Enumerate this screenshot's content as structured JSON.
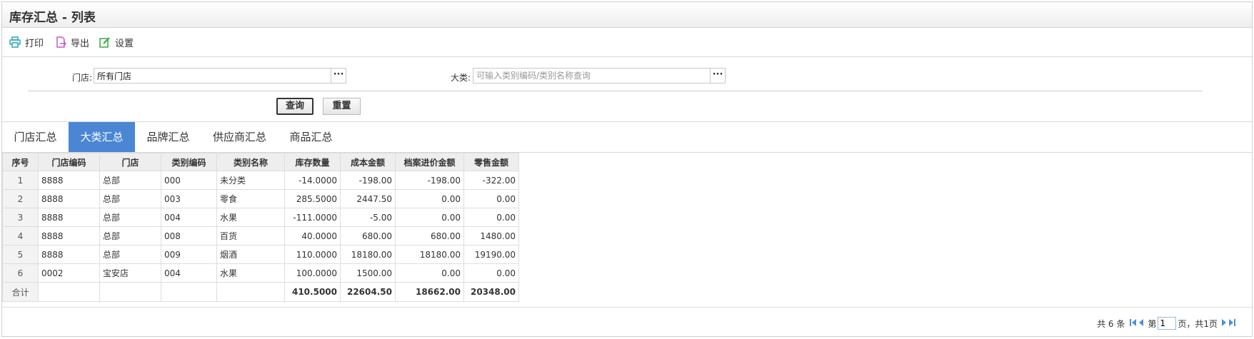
{
  "window": {
    "title": "库存汇总 - 列表"
  },
  "toolbar": {
    "print_label": "打印",
    "export_label": "导出",
    "settings_label": "设置"
  },
  "filters": {
    "store_label": "门店:",
    "store_value": "所有门店",
    "category_label": "大类:",
    "category_placeholder": "可输入类别编码/类别名称查询",
    "lookup_button": "···",
    "query_button": "查询",
    "reset_button": "重置"
  },
  "tabs": [
    {
      "label": "门店汇总",
      "active": false
    },
    {
      "label": "大类汇总",
      "active": true
    },
    {
      "label": "品牌汇总",
      "active": false
    },
    {
      "label": "供应商汇总",
      "active": false
    },
    {
      "label": "商品汇总",
      "active": false
    }
  ],
  "table": {
    "columns": [
      "序号",
      "门店编码",
      "门店",
      "类别编码",
      "类别名称",
      "库存数量",
      "成本金额",
      "档案进价金额",
      "零售金额"
    ],
    "rows": [
      [
        "1",
        "8888",
        "总部",
        "000",
        "未分类",
        "-14.0000",
        "-198.00",
        "-198.00",
        "-322.00"
      ],
      [
        "2",
        "8888",
        "总部",
        "003",
        "零食",
        "285.5000",
        "2447.50",
        "0.00",
        "0.00"
      ],
      [
        "3",
        "8888",
        "总部",
        "004",
        "水果",
        "-111.0000",
        "-5.00",
        "0.00",
        "0.00"
      ],
      [
        "4",
        "8888",
        "总部",
        "008",
        "百货",
        "40.0000",
        "680.00",
        "680.00",
        "1480.00"
      ],
      [
        "5",
        "8888",
        "总部",
        "009",
        "烟酒",
        "110.0000",
        "18180.00",
        "18180.00",
        "19190.00"
      ],
      [
        "6",
        "0002",
        "宝安店",
        "004",
        "水果",
        "100.0000",
        "1500.00",
        "0.00",
        "0.00"
      ]
    ],
    "total": [
      "合计",
      "",
      "",
      "",
      "",
      "410.5000",
      "22604.50",
      "18662.00",
      "20348.00"
    ]
  },
  "pager": {
    "total_text": "共 6 条",
    "page_prefix": "第",
    "page_value": "1",
    "page_suffix": "页，共1页"
  },
  "colors": {
    "tab_active": "#4a86d4",
    "print_icon": "#2aa6b8",
    "export_icon": "#c05bc9",
    "settings_icon": "#3aa845",
    "pager_icon": "#4a90d9"
  }
}
